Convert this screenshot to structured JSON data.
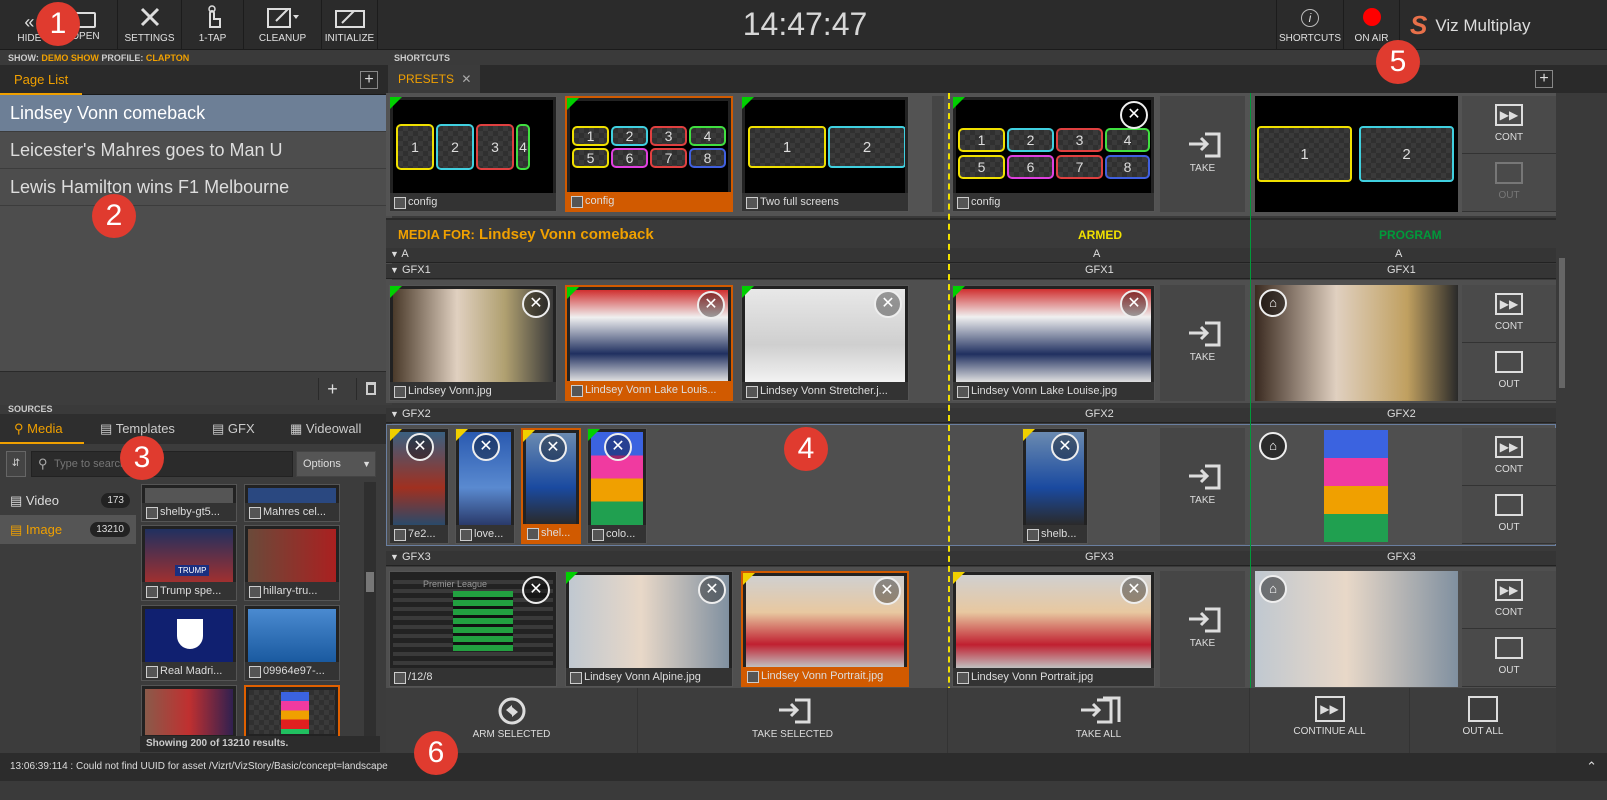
{
  "toolbar": {
    "hide": "HIDE",
    "open": "OPEN",
    "settings": "SETTINGS",
    "onetap": "1-TAP",
    "cleanup": "CLEANUP",
    "initialize": "INITIALIZE",
    "shortcuts": "SHORTCUTS",
    "on_air": "ON AIR",
    "brand": "Viz Multiplay"
  },
  "clock": "14:47:47",
  "show": {
    "show_label": "SHOW:",
    "show_value": "DEMO SHOW",
    "profile_label": "PROFILE:",
    "profile_value": "CLAPTON"
  },
  "shortcuts_header": "SHORTCUTS",
  "page_list": {
    "tab": "Page List",
    "items": [
      "Lindsey Vonn comeback",
      "Leicester's Mahres goes to Man U",
      "Lewis Hamilton wins F1 Melbourne"
    ]
  },
  "sources": {
    "header": "SOURCES",
    "tabs": [
      "Media",
      "Templates",
      "GFX",
      "Videowall"
    ],
    "search_placeholder": "Type to search",
    "options": "Options",
    "categories": [
      {
        "label": "Video",
        "count": "173"
      },
      {
        "label": "Image",
        "count": "13210"
      }
    ],
    "results": "Showing 200 of 13210 results.",
    "thumbs": [
      "shelby-gt5...",
      "Mahres cel...",
      "Trump spe...",
      "hillary-tru...",
      "Real Madri...",
      "09964e97-..."
    ]
  },
  "presets": {
    "tab": "PRESETS",
    "items": [
      "config",
      "config",
      "Two full screens"
    ],
    "armed": "config"
  },
  "media_for": {
    "label": "MEDIA FOR:",
    "value": "Lindsey Vonn comeback"
  },
  "columns": {
    "armed": "ARMED",
    "program": "PROGRAM",
    "a": "A"
  },
  "gfx1": {
    "name": "GFX1",
    "items": [
      "Lindsey Vonn.jpg",
      "Lindsey Vonn Lake Louis...",
      "Lindsey Vonn Stretcher.j..."
    ],
    "armed": "Lindsey Vonn Lake Louise.jpg"
  },
  "gfx2": {
    "name": "GFX2",
    "items": [
      "7e2...",
      "love...",
      "shel...",
      "colo..."
    ],
    "armed": "shelb..."
  },
  "gfx3": {
    "name": "GFX3",
    "items": [
      "/12/8",
      "Lindsey Vonn Alpine.jpg",
      "Lindsey Vonn Portrait.jpg"
    ],
    "armed": "Lindsey Vonn Portrait.jpg",
    "league": "Premier League"
  },
  "actions": {
    "take": "TAKE",
    "cont": "CONT",
    "out": "OUT"
  },
  "bottom": {
    "arm": "ARM SELECTED",
    "take_sel": "TAKE SELECTED",
    "take_all": "TAKE ALL",
    "cont_all": "CONTINUE ALL",
    "out_all": "OUT ALL"
  },
  "status": "13:06:39:114 : Could not find UUID for asset /Vizrt/VizStory/Basic/concept=landscape",
  "badges": [
    "1",
    "2",
    "3",
    "4",
    "5",
    "6"
  ],
  "trump_sign": "TRUMP",
  "colors": {
    "accent": "#f0a000",
    "armed": "#f0d000",
    "program": "#009a3a",
    "onair": "#ff0000",
    "badge": "#e03b2f"
  }
}
